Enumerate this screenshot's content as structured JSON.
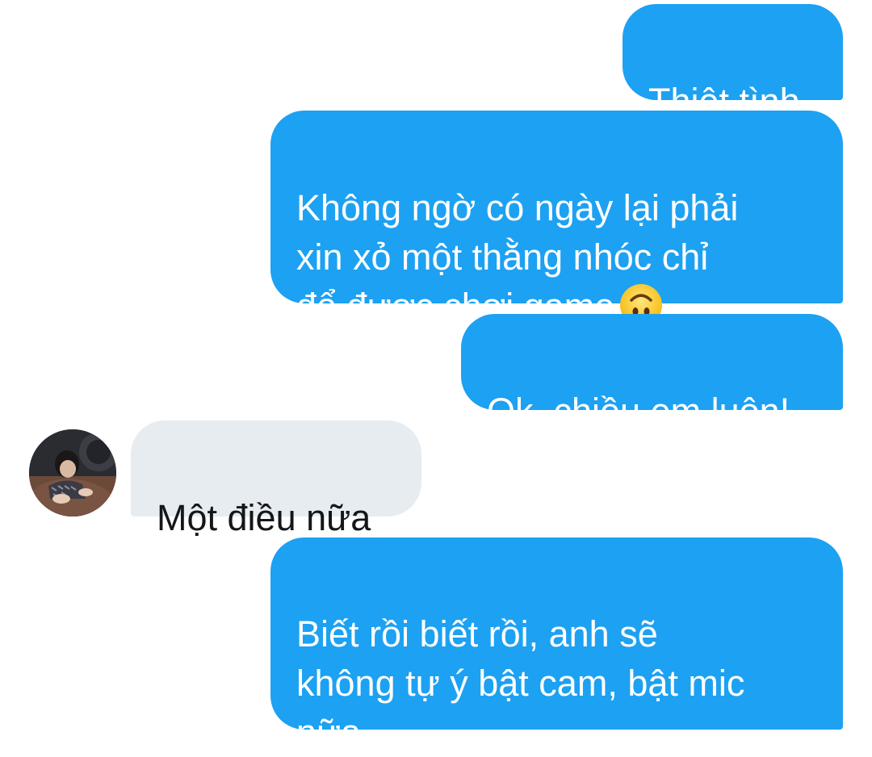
{
  "conversation": {
    "messages": [
      {
        "direction": "out",
        "text": "Thiệt tình"
      },
      {
        "direction": "out",
        "text": "Không ngờ có ngày lại phải\nxin xỏ một thằng nhóc chỉ\nđể được chơi game"
      },
      {
        "direction": "out",
        "text": "Ok, chiều em luôn!"
      },
      {
        "direction": "in",
        "text": "Một điều nữa"
      },
      {
        "direction": "out",
        "text": "Biết rồi biết rồi, anh sẽ\nkhông tự ý bật cam, bật mic\nnữa"
      }
    ],
    "emoji_icon": "upside-down-face-emoji-icon",
    "colors": {
      "outgoing_bubble": "#1da1f2",
      "outgoing_text": "#ffffff",
      "incoming_bubble": "#e6ecf0",
      "incoming_text": "#14171a"
    }
  }
}
